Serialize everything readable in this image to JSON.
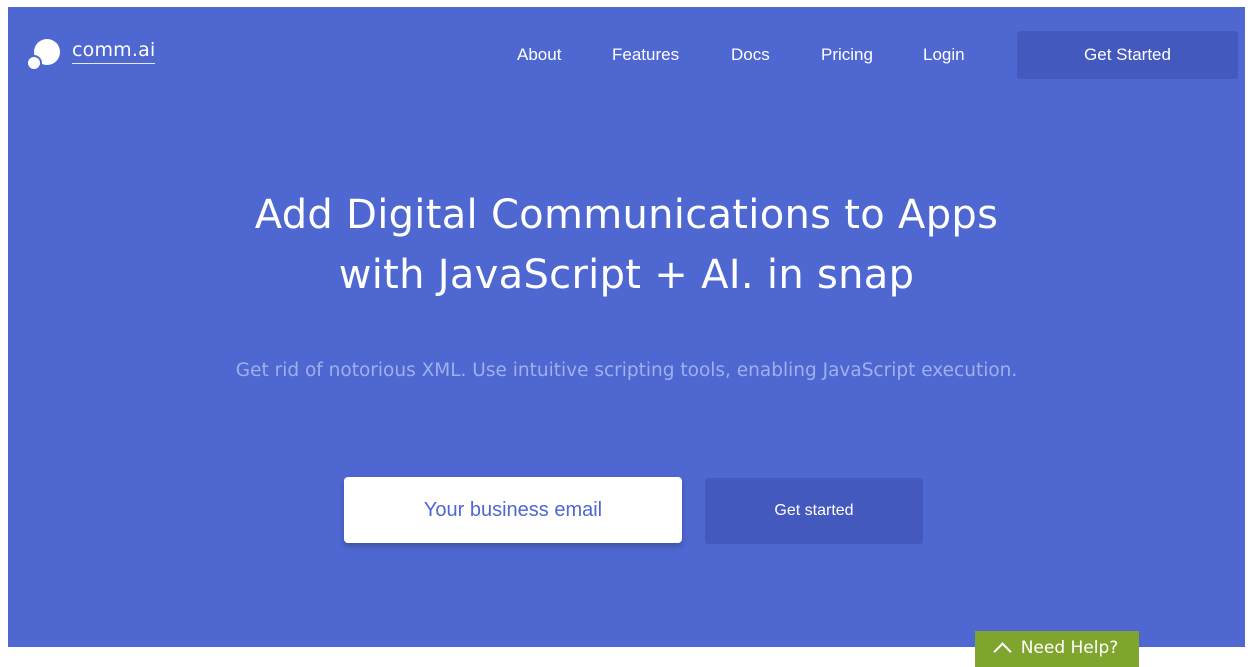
{
  "brand": {
    "name": "comm.ai"
  },
  "nav": {
    "items": [
      "About",
      "Features",
      "Docs",
      "Pricing",
      "Login"
    ],
    "cta_label": "Get Started"
  },
  "hero": {
    "headline_line1": "Add Digital Communications to Apps",
    "headline_line2": "with JavaScript + AI. in snap",
    "subheadline": "Get rid of notorious XML. Use intuitive scripting tools, enabling JavaScript execution.",
    "email_placeholder": "Your business email",
    "email_value": "",
    "submit_label": "Get started"
  },
  "help": {
    "label": "Need Help?",
    "icon": "chevron-up-icon"
  },
  "colors": {
    "hero_background": "#4f67d0",
    "button_background": "#4459bd",
    "subheadline_text": "#9fb0ee",
    "help_tab_background": "#7fa52e"
  }
}
